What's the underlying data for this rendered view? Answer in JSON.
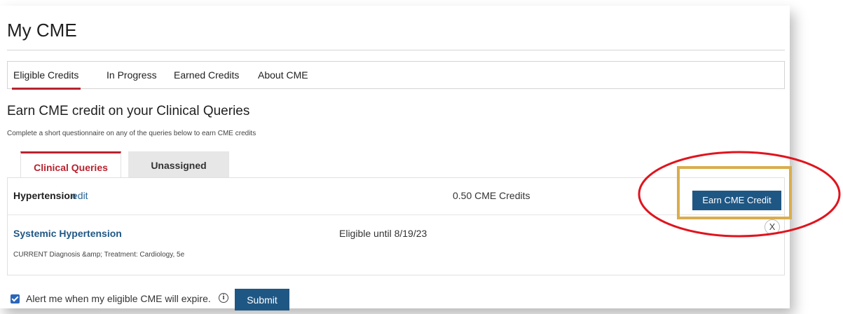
{
  "page": {
    "title": "My CME"
  },
  "main_tabs": [
    {
      "label": "Eligible Credits",
      "active": true
    },
    {
      "label": "In Progress",
      "active": false
    },
    {
      "label": "Earned Credits",
      "active": false
    },
    {
      "label": "About CME",
      "active": false
    }
  ],
  "section": {
    "heading": "Earn CME credit on your Clinical Queries",
    "description": "Complete a short questionnaire on any of the queries below to earn CME credits"
  },
  "sub_tabs": [
    {
      "label": "Clinical Queries",
      "active": true
    },
    {
      "label": "Unassigned",
      "active": false
    }
  ],
  "query": {
    "name": "Hypertension",
    "edit_label": "edit",
    "credits": "0.50 CME Credits",
    "earn_button": "Earn CME Credit",
    "item": {
      "title": "Systemic Hypertension",
      "eligible": "Eligible until 8/19/23",
      "source": "CURRENT Diagnosis &amp; Treatment: Cardiology, 5e",
      "remove_label": "X"
    }
  },
  "alert": {
    "checked": true,
    "label": "Alert me when my eligible CME will expire.",
    "info_icon": "info-icon",
    "submit_label": "Submit"
  },
  "colors": {
    "accent_red": "#b8232f",
    "button_blue": "#1f5784",
    "link_blue": "#2a6496",
    "highlight_box": "#d9ad4e",
    "highlight_ellipse": "#e0141e"
  }
}
